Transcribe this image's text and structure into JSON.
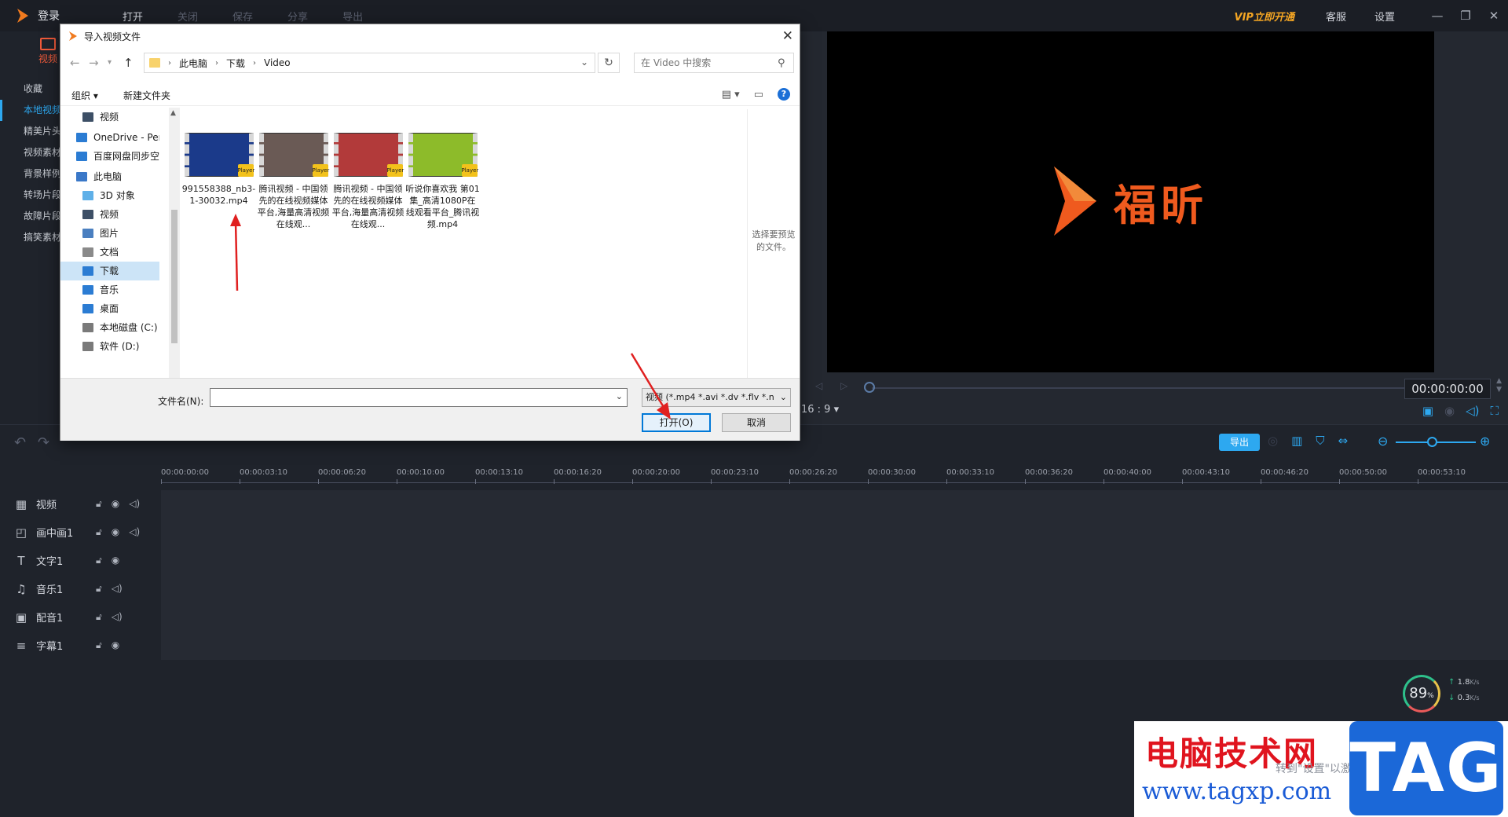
{
  "app": {
    "login": "登录",
    "menu": [
      "打开",
      "关闭",
      "保存",
      "分享",
      "导出"
    ],
    "vip": "VIP立即开通",
    "service": "客服",
    "settings": "设置",
    "window_controls": [
      "minimize-icon",
      "restore-icon",
      "close-icon"
    ]
  },
  "media": {
    "tab_video": "视频",
    "sidebar": [
      "收藏",
      "本地视频",
      "精美片头",
      "视频素材",
      "背景样例",
      "转场片段",
      "故障片段",
      "搞笑素材"
    ],
    "active_index": 1
  },
  "preview": {
    "brand": "福昕",
    "timecode": "00:00:00:00",
    "ratio": "16 : 9",
    "progress": 0
  },
  "toolbar": {
    "export_label": "导出",
    "zoom_level": 0.45
  },
  "timeline": {
    "ticks": [
      "00:00:00:00",
      "00:00:03:10",
      "00:00:06:20",
      "00:00:10:00",
      "00:00:13:10",
      "00:00:16:20",
      "00:00:20:00",
      "00:00:23:10",
      "00:00:26:20",
      "00:00:30:00",
      "00:00:33:10",
      "00:00:36:20",
      "00:00:40:00",
      "00:00:43:10",
      "00:00:46:20",
      "00:00:50:00",
      "00:00:53:10"
    ],
    "tracks": [
      {
        "name": "视频",
        "icon": "film-icon"
      },
      {
        "name": "画中画1",
        "icon": "pip-icon"
      },
      {
        "name": "文字1",
        "icon": "text-icon"
      },
      {
        "name": "音乐1",
        "icon": "music-icon"
      },
      {
        "name": "配音1",
        "icon": "dub-icon"
      },
      {
        "name": "字幕1",
        "icon": "subtitle-icon"
      }
    ]
  },
  "netspeed": {
    "percent": "89",
    "pct_sign": "%",
    "up": "1.8",
    "down": "0.3",
    "unit": "K/s"
  },
  "watermark": {
    "title": "电脑技术网",
    "url": "www.tagxp.com",
    "tag": "TAG",
    "windows_note": "转到\"设置\"以激活Windows。"
  },
  "dialog": {
    "title": "导入视频文件",
    "breadcrumbs": [
      "此电脑",
      "下载",
      "Video"
    ],
    "search_placeholder": "在 Video 中搜索",
    "organize": "组织 ▾",
    "new_folder": "新建文件夹",
    "nav_items": [
      {
        "label": "视频",
        "icon": "video-folder-icon",
        "indent": 1
      },
      {
        "label": "OneDrive - Personal",
        "icon": "onedrive-icon",
        "indent": 0
      },
      {
        "label": "百度网盘同步空间",
        "icon": "baidu-netdisk-icon",
        "indent": 0
      },
      {
        "label": "此电脑",
        "icon": "computer-icon",
        "indent": 0
      },
      {
        "label": "3D 对象",
        "icon": "3d-objects-icon",
        "indent": 1
      },
      {
        "label": "视频",
        "icon": "video-folder-icon",
        "indent": 1
      },
      {
        "label": "图片",
        "icon": "pictures-icon",
        "indent": 1
      },
      {
        "label": "文档",
        "icon": "documents-icon",
        "indent": 1
      },
      {
        "label": "下载",
        "icon": "downloads-icon",
        "indent": 1
      },
      {
        "label": "音乐",
        "icon": "music-note-icon",
        "indent": 1
      },
      {
        "label": "桌面",
        "icon": "desktop-icon",
        "indent": 1
      },
      {
        "label": "本地磁盘 (C:)",
        "icon": "drive-c-icon",
        "indent": 1
      },
      {
        "label": "软件 (D:)",
        "icon": "drive-d-icon",
        "indent": 1
      }
    ],
    "selected_nav": 8,
    "files": [
      {
        "name": "991558388_nb3-1-30032.mp4",
        "thumb": "#1b3a8a",
        "badge": "Player"
      },
      {
        "name": "腾讯视频 - 中国领先的在线视频媒体平台,海量高清视频在线观...",
        "thumb": "#6a5a55",
        "badge": "Player"
      },
      {
        "name": "腾讯视频 - 中国领先的在线视频媒体平台,海量高清视频在线观...",
        "thumb": "#b23a3a",
        "badge": "Player"
      },
      {
        "name": "听说你喜欢我 第01集_高清1080P在线观看平台_腾讯视频.mp4",
        "thumb": "#8dbb2a",
        "badge": "Player"
      }
    ],
    "preview_hint": "选择要预览的文件。",
    "filename_label": "文件名(N):",
    "filename_value": "",
    "filetype": "视频 (*.mp4 *.avi *.dv *.flv *.n",
    "open_label": "打开(O)",
    "cancel_label": "取消"
  }
}
